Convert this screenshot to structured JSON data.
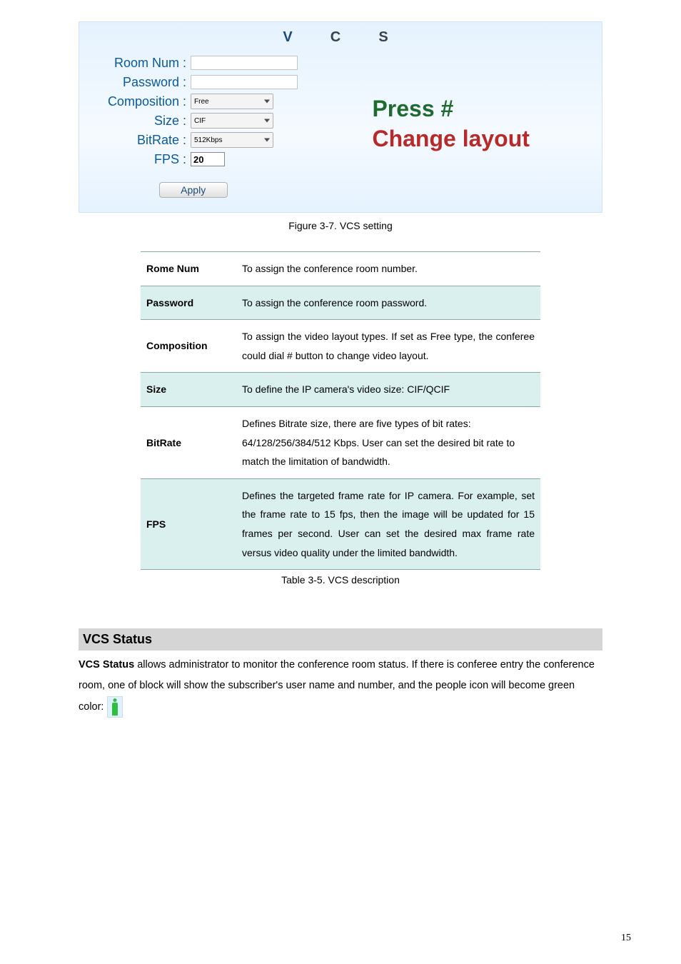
{
  "vcs_header": "V C S",
  "form": {
    "room_num_label": "Room Num :",
    "room_num_value": "",
    "password_label": "Password :",
    "password_value": "",
    "composition_label": "Composition :",
    "composition_value": "Free",
    "size_label": "Size :",
    "size_value": "CIF",
    "bitrate_label": "BitRate :",
    "bitrate_value": "512Kbps",
    "fps_label": "FPS :",
    "fps_value": "20",
    "apply_label": "Apply"
  },
  "right_text_line1": "Press #",
  "right_text_line2": "Change layout",
  "figure_caption": "Figure 3-7. VCS setting",
  "table_rows": [
    {
      "shade": false,
      "name": "Rome Num",
      "desc": "To assign the conference room number."
    },
    {
      "shade": true,
      "name": "Password",
      "desc": "To assign the conference room password."
    },
    {
      "shade": false,
      "name": "Composition",
      "desc": "To assign the video layout types. If set as Free type, the conferee could dial # button to change video layout.",
      "justify": true
    },
    {
      "shade": true,
      "name": "Size",
      "desc": "To define the IP camera's video size: CIF/QCIF"
    },
    {
      "shade": false,
      "name": "BitRate",
      "desc": "Defines Bitrate size, there are five types of bit rates: 64/128/256/384/512 Kbps. User can set the desired bit rate to match the limitation of bandwidth."
    },
    {
      "shade": true,
      "name": "FPS",
      "desc": "Defines the targeted frame rate for IP camera. For example, set the frame rate to 15 fps, then the image will be updated for 15 frames per second. User can set the desired max frame rate versus video quality under the limited bandwidth.",
      "justify": true
    }
  ],
  "table_caption": "Table 3-5. VCS description",
  "section_heading": "VCS Status",
  "body_bold": "VCS Status",
  "body_rest": " allows administrator to monitor the conference room status. If there is conferee entry the conference room, one of block will show the subscriber's user name and number, and the people icon will become green color: ",
  "page_number": "15"
}
